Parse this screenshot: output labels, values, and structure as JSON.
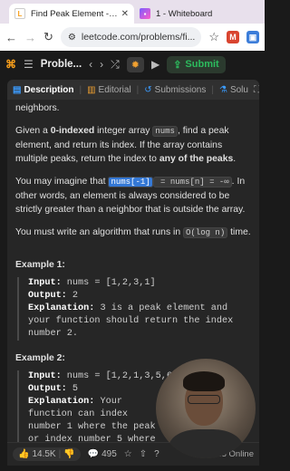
{
  "browser": {
    "tabs": [
      {
        "title": "Find Peak Element - LeetCode",
        "favicon": "leetcode-favicon",
        "active": true
      },
      {
        "title": "1 - Whiteboard",
        "favicon": "whiteboard-favicon",
        "active": false
      }
    ],
    "url": "leetcode.com/problems/fi..."
  },
  "lc_header": {
    "problems_label": "Proble...",
    "submit_label": "Submit"
  },
  "panel_tabs": {
    "description": "Description",
    "editorial": "Editorial",
    "submissions": "Submissions",
    "solutions": "Solu"
  },
  "description": {
    "top_fragment": "neighbors.",
    "p1_pre": "Given a ",
    "p1_bold1": "0-indexed",
    "p1_mid1": " integer array ",
    "p1_code1": "nums",
    "p1_mid2": ", find a peak element, and return its index. If the array contains multiple peaks, return the index to ",
    "p1_bold2": "any of the peaks",
    "p1_end": ".",
    "p2_pre": "You may imagine that ",
    "p2_code_sel": "nums[-1]",
    "p2_code2": " = nums[n] = -∞",
    "p2_end": ". In other words, an element is always considered to be strictly greater than a neighbor that is outside the array.",
    "p3_pre": "You must write an algorithm that runs in ",
    "p3_code": "O(log n)",
    "p3_end": " time."
  },
  "examples": [
    {
      "title": "Example 1:",
      "input_label": "Input:",
      "input": " nums = [1,2,3,1]",
      "output_label": "Output:",
      "output": " 2",
      "explanation_label": "Explanation:",
      "explanation": " 3 is a peak element and your function should return the index number 2."
    },
    {
      "title": "Example 2:",
      "input_label": "Input:",
      "input": " nums = [1,2,1,3,5,6,4]",
      "output_label": "Output:",
      "output": " 5",
      "explanation_label": "Explanation:",
      "explanation": " Your function can index number 1 where the peak or index number 5 where the 6."
    }
  ],
  "footer": {
    "likes": "14.5K",
    "comments": "495",
    "online": "45 Online"
  },
  "colors": {
    "accent_green": "#2cbb5d",
    "selection_blue": "#3478d6",
    "panel_bg": "#262626"
  }
}
